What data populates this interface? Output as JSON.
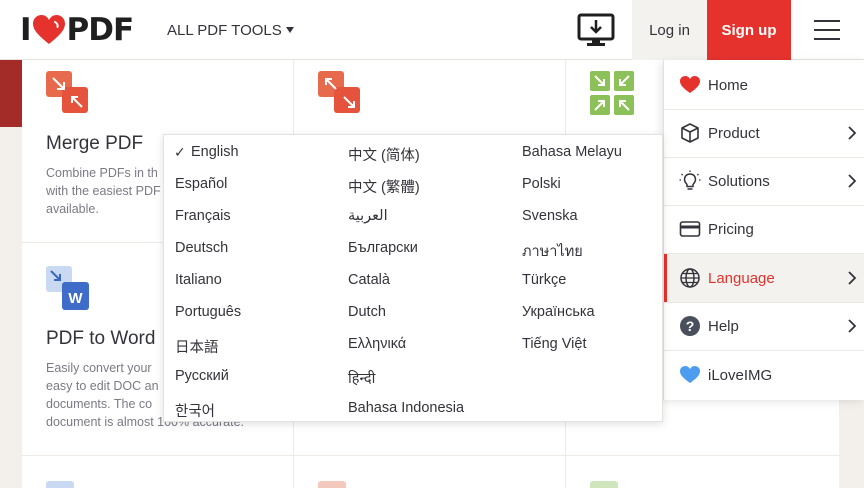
{
  "header": {
    "logo_left": "I",
    "logo_right": "PDF",
    "tools_label": "ALL PDF TOOLS",
    "login_label": "Log in",
    "signup_label": "Sign up"
  },
  "cards": [
    {
      "title": "Merge PDF",
      "desc_lines": [
        "Combine PDFs in th",
        "with the easiest PDF",
        "available."
      ]
    },
    {
      "title": "PDF to Word",
      "desc_lines": [
        "Easily convert your",
        "easy to edit DOC an",
        "documents. The co",
        "document is almost 100% accurate."
      ]
    }
  ],
  "languages": {
    "selected": "English",
    "columns": [
      [
        "English",
        "Español",
        "Français",
        "Deutsch",
        "Italiano",
        "Português",
        "日本語",
        "Русский",
        "한국어"
      ],
      [
        "中文 (简体)",
        "中文 (繁體)",
        "العربية",
        "Български",
        "Català",
        "Dutch",
        "Ελληνικά",
        "हिन्दी",
        "Bahasa Indonesia"
      ],
      [
        "Bahasa Melayu",
        "Polski",
        "Svenska",
        "ภาษาไทย",
        "Türkçe",
        "Українська",
        "Tiếng Việt"
      ]
    ]
  },
  "side_menu": {
    "items": [
      {
        "label": "Home",
        "icon": "heart-icon",
        "has_submenu": false
      },
      {
        "label": "Product",
        "icon": "box-icon",
        "has_submenu": true
      },
      {
        "label": "Solutions",
        "icon": "lightbulb-icon",
        "has_submenu": true
      },
      {
        "label": "Pricing",
        "icon": "credit-card-icon",
        "has_submenu": false
      },
      {
        "label": "Language",
        "icon": "globe-icon",
        "has_submenu": true,
        "active": true
      },
      {
        "label": "Help",
        "icon": "help-icon",
        "has_submenu": true
      },
      {
        "label": "iLoveIMG",
        "icon": "ilovimg-heart-icon",
        "has_submenu": false
      }
    ]
  },
  "colors": {
    "brand_red": "#e5322d",
    "text_dark": "#33333b",
    "ilovimg_blue": "#4d9cf0"
  }
}
